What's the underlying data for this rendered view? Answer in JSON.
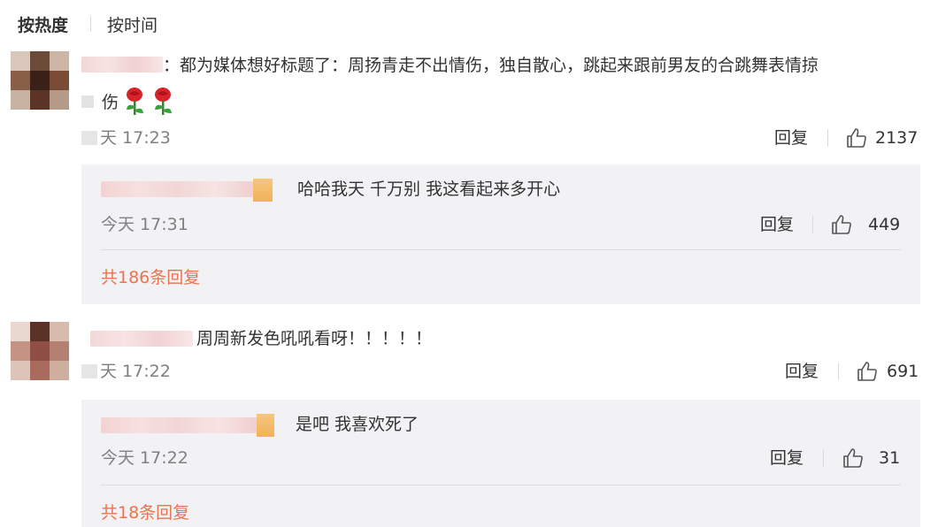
{
  "sort_tabs": {
    "hot": "按热度",
    "time": "按时间"
  },
  "comments": [
    {
      "text_line1": "：都为媒体想好标题了：周扬青走不出情伤，独自散心，跳起来跟前男友的合跳舞表情掠",
      "text_line2": "伤",
      "time": "天 17:23",
      "reply_label": "回复",
      "likes": "2137",
      "reply": {
        "text": "哈哈我天 千万别 我这看起来多开心",
        "time": "今天 17:31",
        "reply_label": "回复",
        "likes": "449"
      },
      "more_replies": "共186条回复"
    },
    {
      "text_line1": "周周新发色吼吼看呀！！！！！",
      "time": "天 17:22",
      "reply_label": "回复",
      "likes": "691",
      "reply": {
        "text": "是吧 我喜欢死了",
        "time": "今天 17:22",
        "reply_label": "回复",
        "likes": "31"
      },
      "more_replies": "共18条回复"
    }
  ],
  "colors": {
    "link_orange": "#eb7350",
    "reply_bg": "#f2f2f5",
    "muted_text": "#808080"
  },
  "icons": {
    "like": "thumbs-up-icon",
    "emoji": "rose-emoji-icon"
  }
}
